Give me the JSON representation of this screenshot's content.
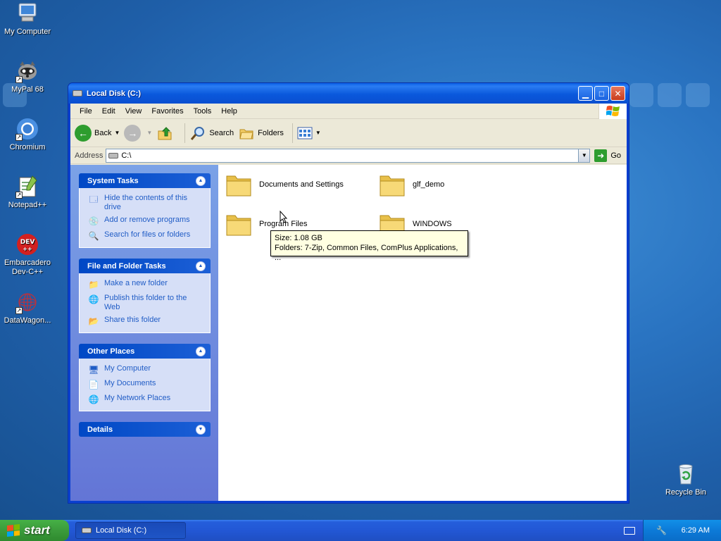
{
  "desktop": {
    "icons": [
      {
        "label": "My Computer"
      },
      {
        "label": "MyPal 68"
      },
      {
        "label": "Chromium"
      },
      {
        "label": "Notepad++"
      },
      {
        "label": "Embarcadero Dev-C++",
        "badge": "DEV"
      },
      {
        "label": "DataWagon..."
      },
      {
        "label": "Recycle Bin"
      }
    ]
  },
  "window": {
    "title": "Local Disk (C:)",
    "menu": [
      "File",
      "Edit",
      "View",
      "Favorites",
      "Tools",
      "Help"
    ],
    "toolbar": {
      "back": "Back",
      "search": "Search",
      "folders": "Folders"
    },
    "address": {
      "label": "Address",
      "value": "C:\\",
      "go": "Go"
    },
    "left_pane": {
      "system_tasks": {
        "title": "System Tasks",
        "items": [
          "Hide the contents of this drive",
          "Add or remove programs",
          "Search for files or folders"
        ]
      },
      "file_folder_tasks": {
        "title": "File and Folder Tasks",
        "items": [
          "Make a new folder",
          "Publish this folder to the Web",
          "Share this folder"
        ]
      },
      "other_places": {
        "title": "Other Places",
        "items": [
          "My Computer",
          "My Documents",
          "My Network Places"
        ]
      },
      "details": {
        "title": "Details"
      }
    },
    "folders": [
      "Documents and Settings",
      "glf_demo",
      "Program Files",
      "WINDOWS"
    ],
    "tooltip": {
      "line1": "Size: 1.08 GB",
      "line2": "Folders: 7-Zip, Common Files, ComPlus Applications, ..."
    }
  },
  "taskbar": {
    "start": "start",
    "task": "Local Disk (C:)",
    "clock": "6:29 AM"
  },
  "colors": {
    "title_blue": "#0a58dc",
    "panel_link": "#215dc6",
    "start_green": "#3c9d3c",
    "tooltip_bg": "#ffffe1"
  }
}
